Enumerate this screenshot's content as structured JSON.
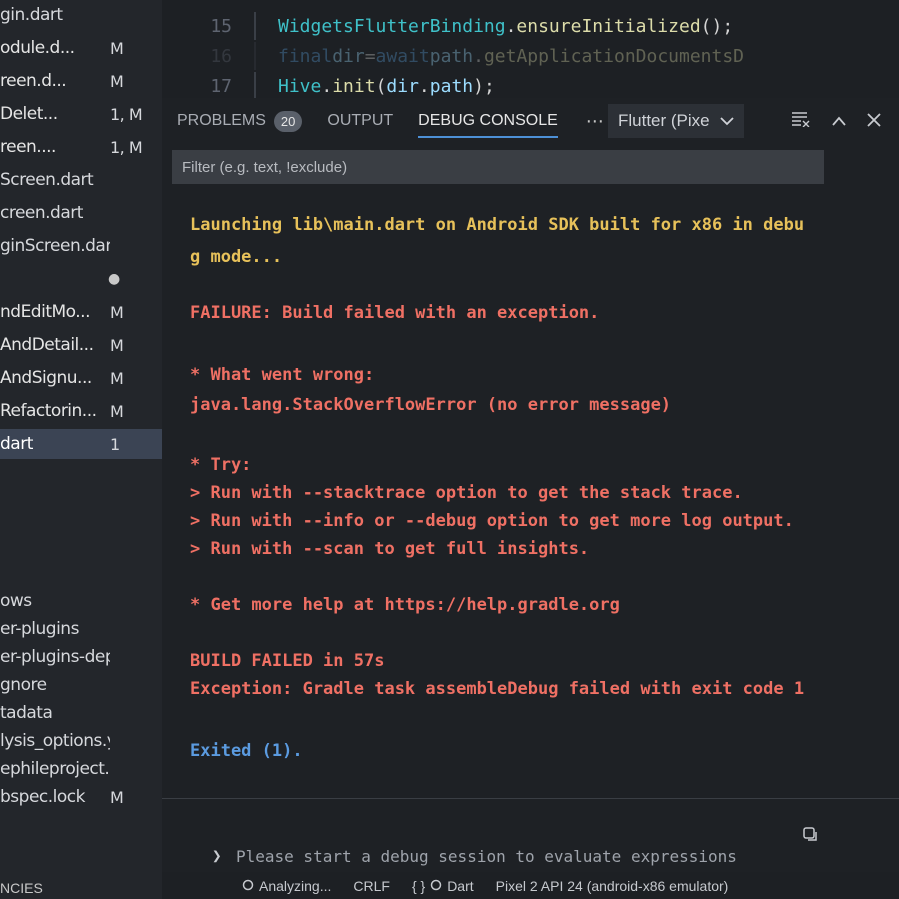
{
  "sidebar": {
    "files": [
      {
        "name": "gin.dart",
        "badge": "",
        "state": "normal"
      },
      {
        "name": "odule.d...",
        "badge": "M",
        "state": "modified"
      },
      {
        "name": "reen.d...",
        "badge": "M",
        "state": "modified"
      },
      {
        "name": "Delet...",
        "badge": "1, M",
        "state": "modified"
      },
      {
        "name": "reen....",
        "badge": "1, M",
        "state": "modified"
      },
      {
        "name": "Screen.dart",
        "badge": "",
        "state": "normal"
      },
      {
        "name": "creen.dart",
        "badge": "",
        "state": "normal"
      },
      {
        "name": "ginScreen.dart",
        "badge": "",
        "state": "normal"
      },
      {
        "name": "",
        "badge": "●",
        "state": "dot"
      },
      {
        "name": "ndEditMo...",
        "badge": "M",
        "state": "modified"
      },
      {
        "name": "AndDetail...",
        "badge": "M",
        "state": "modified"
      },
      {
        "name": "AndSignu...",
        "badge": "M",
        "state": "modified"
      },
      {
        "name": "Refactorin...",
        "badge": "M",
        "state": "modified"
      },
      {
        "name": "dart",
        "badge": "1",
        "state": "selected"
      }
    ],
    "files2": [
      {
        "name": "ows",
        "badge": ""
      },
      {
        "name": "er-plugins",
        "badge": ""
      },
      {
        "name": "er-plugins-depend...",
        "badge": ""
      },
      {
        "name": "gnore",
        "badge": ""
      },
      {
        "name": "tadata",
        "badge": ""
      },
      {
        "name": "lysis_options.yaml",
        "badge": ""
      },
      {
        "name": "ephileproject.iml",
        "badge": ""
      },
      {
        "name": "bspec.lock",
        "badge": "M"
      }
    ],
    "bottom_label": "NCIES"
  },
  "editor": {
    "lines": [
      {
        "no": "15",
        "tokens": [
          [
            "WidgetsFlutterBinding",
            "type"
          ],
          [
            ".",
            "punc"
          ],
          [
            "ensureInitialized",
            "fn"
          ],
          [
            "();",
            "punc"
          ]
        ]
      },
      {
        "no": "16",
        "tokens": [
          [
            "final ",
            "kw"
          ],
          [
            "dir",
            "var"
          ],
          [
            " = ",
            "punc"
          ],
          [
            "await ",
            "kw"
          ],
          [
            "path",
            "var"
          ],
          [
            ".",
            "punc"
          ],
          [
            "getApplicationDocumentsD",
            "fn"
          ]
        ]
      },
      {
        "no": "17",
        "tokens": [
          [
            "Hive",
            "type"
          ],
          [
            ".",
            "punc"
          ],
          [
            "init",
            "fn"
          ],
          [
            "(",
            "punc"
          ],
          [
            "dir",
            "var"
          ],
          [
            ".",
            "punc"
          ],
          [
            "path",
            "var"
          ],
          [
            ");",
            "punc"
          ]
        ]
      }
    ]
  },
  "panel": {
    "tabs": {
      "problems": "PROBLEMS",
      "problems_count": "20",
      "output": "OUTPUT",
      "debug_console": "DEBUG CONSOLE"
    },
    "more_icon": "⋯",
    "launch_target": "Flutter (Pixe",
    "filter_placeholder": "Filter (e.g. text, !exclude)",
    "console": [
      {
        "text": "Launching lib\\main.dart on Android SDK built for x86 in debu",
        "kind": "info"
      },
      {
        "text": "g mode...",
        "kind": "info"
      },
      {
        "text": "FAILURE: Build failed with an exception.",
        "kind": "err"
      },
      {
        "text": "* What went wrong:",
        "kind": "err"
      },
      {
        "text": "java.lang.StackOverflowError (no error message)",
        "kind": "err"
      },
      {
        "text": "* Try:",
        "kind": "err"
      },
      {
        "text": "> Run with --stacktrace option to get the stack trace.",
        "kind": "err"
      },
      {
        "text": "> Run with --info or --debug option to get more log output.",
        "kind": "err"
      },
      {
        "text": "> Run with --scan to get full insights.",
        "kind": "err"
      },
      {
        "text": "* Get more help at https://help.gradle.org",
        "kind": "err"
      },
      {
        "text": "BUILD FAILED in 57s",
        "kind": "err"
      },
      {
        "text": "Exception: Gradle task assembleDebug failed with exit code 1",
        "kind": "err"
      },
      {
        "text": "Exited (1).",
        "kind": "exit"
      }
    ],
    "repl_placeholder": "Please start a debug session to evaluate expressions"
  },
  "statusbar": {
    "analyzing": "Analyzing...",
    "eol": "CRLF",
    "language_braces": "{ }",
    "language": "Dart",
    "device": "Pixel 2 API 24 (android-x86 emulator)"
  },
  "colors": {
    "info_text": "#e7c15a",
    "error_text": "#ef7064",
    "exit_text": "#5b9be0",
    "active_tab_underline": "#4d90d6"
  }
}
